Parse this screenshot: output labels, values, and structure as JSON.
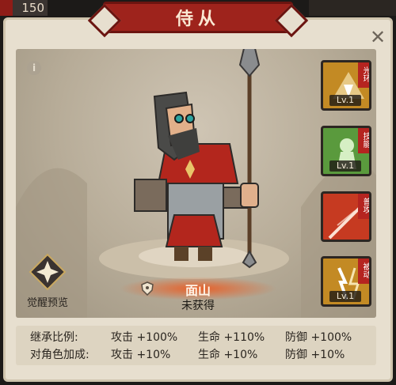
{
  "resource": {
    "value": "150"
  },
  "header": {
    "title": "侍从"
  },
  "portrait": {
    "name": "面山",
    "status": "未获得"
  },
  "awaken": {
    "label": "觉醒预览"
  },
  "skills": [
    {
      "tag": "光环",
      "level": "Lv.1",
      "color": "#c38a24"
    },
    {
      "tag": "技能",
      "level": "Lv.1",
      "color": "#5a9a3d"
    },
    {
      "tag": "普攻",
      "level": "",
      "color": "#c63a21"
    },
    {
      "tag": "被动",
      "level": "Lv.1",
      "color": "#c38a24"
    }
  ],
  "inherit": {
    "rows": [
      {
        "label": "继承比例:",
        "attack": "攻击 +100%",
        "hp": "生命 +110%",
        "def": "防御 +100%"
      },
      {
        "label": "对角色加成:",
        "attack": "攻击 +10%",
        "hp": "生命 +10%",
        "def": "防御 +10%"
      }
    ]
  }
}
